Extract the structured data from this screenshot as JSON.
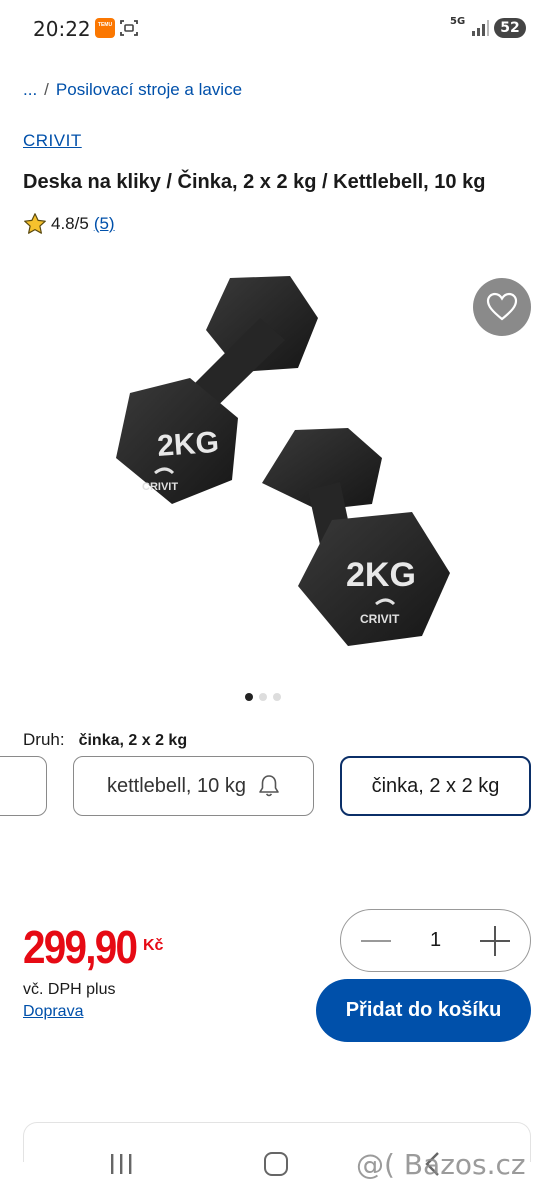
{
  "status_bar": {
    "time": "20:22",
    "temu_label": "TEMU",
    "network": "5G",
    "battery": "52"
  },
  "breadcrumb": {
    "ellipsis": "...",
    "separator": "/",
    "category": "Posilovací stroje a lavice"
  },
  "product": {
    "brand": "CRIVIT",
    "title": "Deska na kliky / Činka, 2 x 2 kg / Kettlebell, 10 kg",
    "rating": "4.8/5",
    "review_count": "(5)",
    "image_label_weight": "2KG",
    "image_label_brand": "CRIVIT"
  },
  "carousel": {
    "total": 3,
    "active": 1
  },
  "variant": {
    "label": "Druh:",
    "selected_value": "činka, 2 x 2 kg",
    "options": [
      {
        "label": ""
      },
      {
        "label": "kettlebell, 10 kg"
      },
      {
        "label": "činka, 2 x 2 kg"
      }
    ]
  },
  "pricing": {
    "price": "299,90",
    "currency": "Kč",
    "vat_note": "vč. DPH plus",
    "shipping_link": "Doprava"
  },
  "cart": {
    "quantity": "1",
    "add_button": "Přidat do košíku"
  },
  "watermark": "@( Bazos.cz",
  "colors": {
    "link": "#0050aa",
    "price": "#e60a14",
    "primary_button": "#0050aa",
    "selected_border": "#0b2f68"
  }
}
